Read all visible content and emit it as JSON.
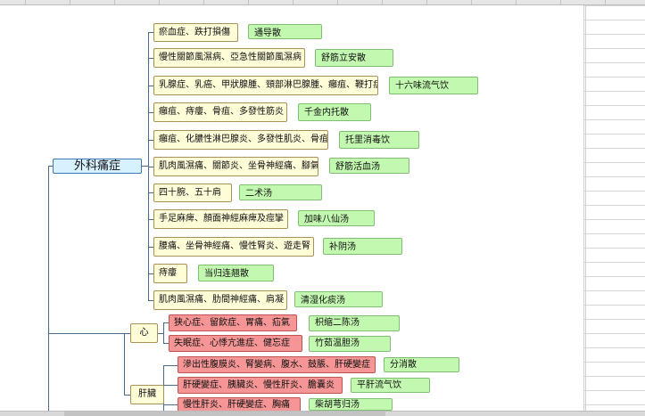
{
  "root": {
    "label": "外科痛症"
  },
  "branches": [
    {
      "symptom": "瘀血症、跌打損傷",
      "remedy": "通导散"
    },
    {
      "symptom": "慢性關節風濕病、亞急性關節風濕病",
      "remedy": "舒筋立安散"
    },
    {
      "symptom": "乳腺症、乳癌、甲狀腺腫、頸部淋巴腺腫、癰疽、鞭打症",
      "remedy": "十六味流气饮"
    },
    {
      "symptom": "癰疽、痔瘻、骨疽、多發性筋炎",
      "remedy": "千金内托散"
    },
    {
      "symptom": "癰疽、化膿性淋巴腺炎、多發性肌炎、骨疽",
      "remedy": "托里消毒饮"
    },
    {
      "symptom": "肌肉風濕痛、關節炎、坐骨神經痛、腳氣",
      "remedy": "舒筋活血汤"
    },
    {
      "symptom": "四十腕、五十肩",
      "remedy": "二术汤"
    },
    {
      "symptom": "手足麻痺、顏面神經麻痺及痙攣",
      "remedy": "加味八仙汤"
    },
    {
      "symptom": "腰痛、坐骨神經痛、慢性腎炎、遊走腎",
      "remedy": "补阴汤"
    },
    {
      "symptom": "痔瘻",
      "remedy": "当归连翘散"
    },
    {
      "symptom": "肌肉風濕痛、肋間神經痛、肩凝",
      "remedy": "清湿化痰汤"
    }
  ],
  "groups": [
    {
      "label": "心",
      "items": [
        {
          "symptom": "狭心症、留飲症、胃痛、疝氣",
          "remedy": "枳缩二陈汤"
        },
        {
          "symptom": "失眠症、心悸亢進症、健忘症",
          "remedy": "竹茹温胆汤"
        }
      ]
    },
    {
      "label": "肝臟",
      "items": [
        {
          "symptom": "滲出性腹膜炎、腎變病、腹水、鼓脹、肝硬變症",
          "remedy": "分消散"
        },
        {
          "symptom": "肝硬變症、胰臟炎、慢性肝炎、膽囊炎",
          "remedy": "平肝流气饮"
        },
        {
          "symptom": "慢性肝炎、肝硬變症、胸痛",
          "remedy": "柴胡芎归汤"
        }
      ]
    }
  ],
  "colors": {
    "root_fill": "#d7f1ff",
    "symptom_fill": "#fffcd8",
    "organ_fill": "#f59595",
    "remedy_fill": "#c3f8b0"
  }
}
